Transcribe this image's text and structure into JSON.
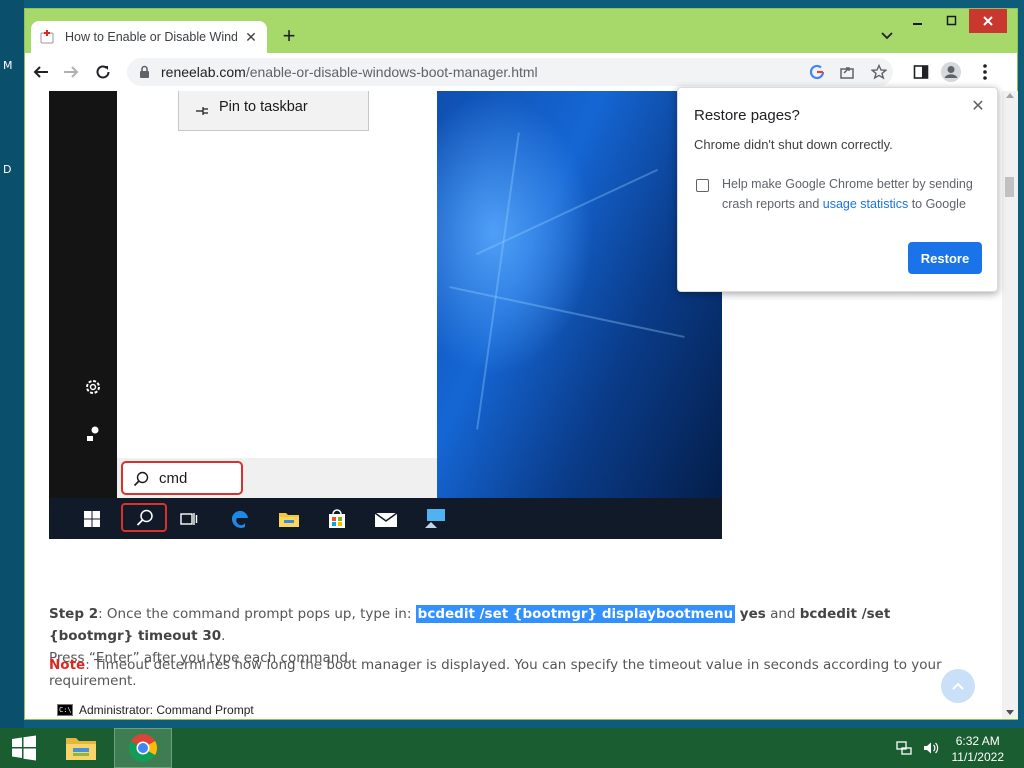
{
  "desktop": {
    "letters": [
      "M",
      "D"
    ]
  },
  "browser": {
    "tab_title": "How to Enable or Disable Windows Boot Manager",
    "url_domain": "reneelab.com",
    "url_path": "/enable-or-disable-windows-boot-manager.html"
  },
  "screenshot": {
    "pin_label": "Pin to taskbar",
    "search_text": "cmd"
  },
  "article": {
    "step_label": "Step 2",
    "step_intro": ": Once the command prompt pops up, type in: ",
    "cmd1": "bcdedit /set {bootmgr} displaybootmenu",
    "cmd1_tail": " yes",
    "and_text": " and ",
    "cmd2": "bcdedit /set {bootmgr} timeout 30",
    "period": ".",
    "step_line2": "Press “Enter” after you type each command.",
    "note_label": "Note",
    "note_text": ": Timeout determines how long the boot manager is displayed. You can specify the timeout value in seconds according to your requirement.",
    "cmd_caption": "Administrator: Command Prompt"
  },
  "popup": {
    "title": "Restore pages?",
    "message": "Chrome didn't shut down correctly.",
    "help_text": "Help make Google Chrome better by sending crash reports and ",
    "link_text": "usage statistics",
    "help_tail": " to Google",
    "restore_label": "Restore"
  },
  "taskbar": {
    "time": "6:32 AM",
    "date": "11/1/2022"
  },
  "colors": {
    "window_frame": "#a6d96a",
    "accent_blue": "#1a73e8",
    "highlight_red": "#d9322b",
    "note_red": "#e0261f",
    "taskbar": "#1a5d30"
  }
}
